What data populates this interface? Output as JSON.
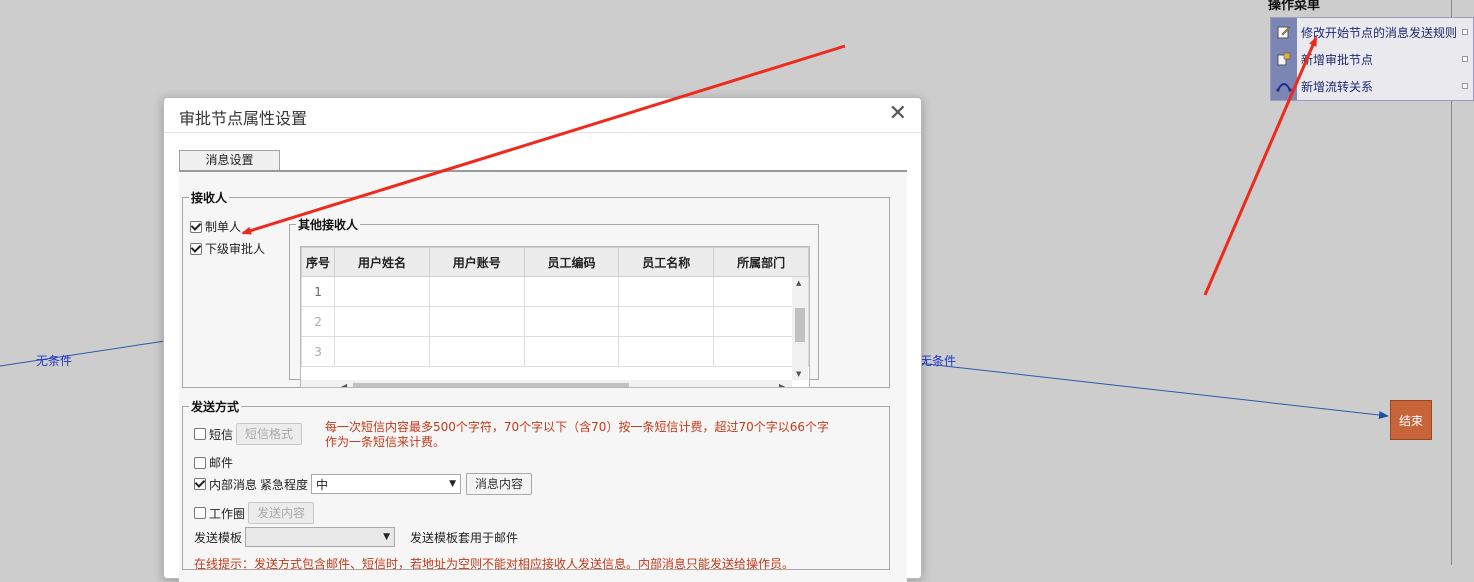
{
  "canvas": {
    "left_edge_label": "无条件",
    "right_edge_label": "无条件",
    "end_node": "结束"
  },
  "op_menu": {
    "title": "操作菜单",
    "items": [
      {
        "label": "修改开始节点的消息发送规则",
        "icon": "edit-icon"
      },
      {
        "label": "新增审批节点",
        "icon": "add-node-icon"
      },
      {
        "label": "新增流转关系",
        "icon": "link-icon"
      }
    ]
  },
  "dialog": {
    "title": "审批节点属性设置",
    "tab": "消息设置",
    "receivers": {
      "legend": "接收人",
      "creator": {
        "label": "制单人",
        "checked": true
      },
      "next_approver": {
        "label": "下级审批人",
        "checked": true
      },
      "others": {
        "legend": "其他接收人",
        "columns": [
          "序号",
          "用户姓名",
          "用户账号",
          "员工编码",
          "员工名称",
          "所属部门"
        ],
        "rows": [
          "1",
          "2",
          "3"
        ]
      }
    },
    "send": {
      "legend": "发送方式",
      "sms": {
        "label": "短信",
        "checked": false,
        "button": "短信格式"
      },
      "sms_note": "每一次短信内容最多500个字符，70个字以下（含70）按一条短信计费，超过70个字以66个字作为一条短信来计费。",
      "email": {
        "label": "邮件",
        "checked": false
      },
      "internal": {
        "label": "内部消息",
        "checked": true,
        "urgency_label": "紧急程度",
        "urgency_value": "中",
        "button": "消息内容"
      },
      "workcircle": {
        "label": "工作圈",
        "checked": false,
        "button": "发送内容"
      },
      "template": {
        "label": "发送模板",
        "value": "",
        "note": "发送模板套用于邮件"
      },
      "hint": "在线提示：发送方式包含邮件、短信时，若地址为空则不能对相应接收人发送信息。内部消息只能发送给操作员。"
    }
  }
}
